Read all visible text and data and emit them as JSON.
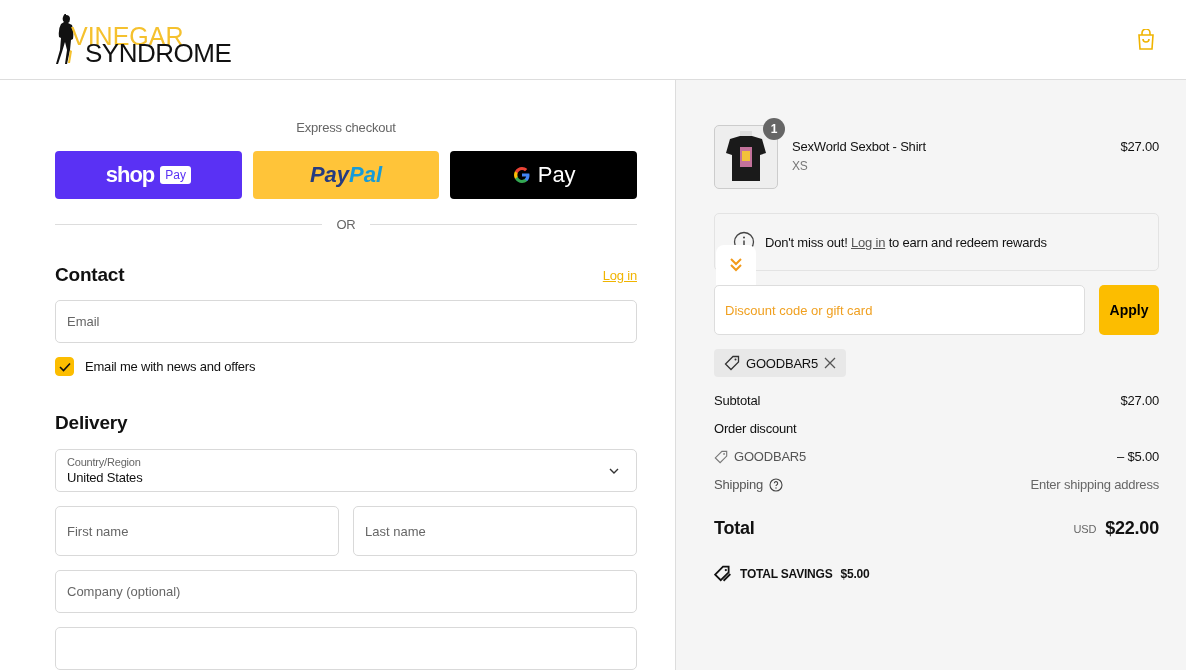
{
  "header": {
    "logo": {
      "top": "VINEGAR",
      "bottom": "SYNDROME"
    }
  },
  "express": {
    "title": "Express checkout",
    "buttons": [
      {
        "kind": "shop",
        "label": "shop",
        "badge": "Pay"
      },
      {
        "kind": "paypal",
        "parts": [
          "Pay",
          "Pal"
        ]
      },
      {
        "kind": "gpay",
        "label": "Pay"
      }
    ],
    "divider": "OR"
  },
  "contact": {
    "title": "Contact",
    "login_link": "Log in",
    "email_placeholder": "Email",
    "newsletter": {
      "label": "Email me with news and offers",
      "checked": true
    }
  },
  "delivery": {
    "title": "Delivery",
    "country": {
      "label": "Country/Region",
      "value": "United States"
    },
    "first_name_placeholder": "First name",
    "last_name_placeholder": "Last name",
    "company_placeholder": "Company (optional)"
  },
  "summary": {
    "items": [
      {
        "name": "SexWorld Sexbot - Shirt",
        "variant": "XS",
        "price": "$27.00",
        "quantity": "1"
      }
    ],
    "notice": {
      "before": "Don't miss out!",
      "link": "Log in",
      "after": "to earn and redeem rewards"
    },
    "discount": {
      "placeholder": "Discount code or gift card",
      "button": "Apply"
    },
    "applied_codes": [
      "GOODBAR5"
    ],
    "lines": [
      {
        "kind": "plain",
        "label": "Subtotal",
        "value": "$27.00"
      },
      {
        "kind": "heading",
        "label": "Order discount"
      },
      {
        "kind": "code",
        "label": "GOODBAR5",
        "value": "– $5.00"
      },
      {
        "kind": "help",
        "label": "Shipping",
        "value": "Enter shipping address"
      }
    ],
    "total": {
      "label": "Total",
      "currency": "USD",
      "value": "$22.00"
    },
    "savings": {
      "label": "TOTAL SAVINGS",
      "value": "$5.00"
    }
  }
}
